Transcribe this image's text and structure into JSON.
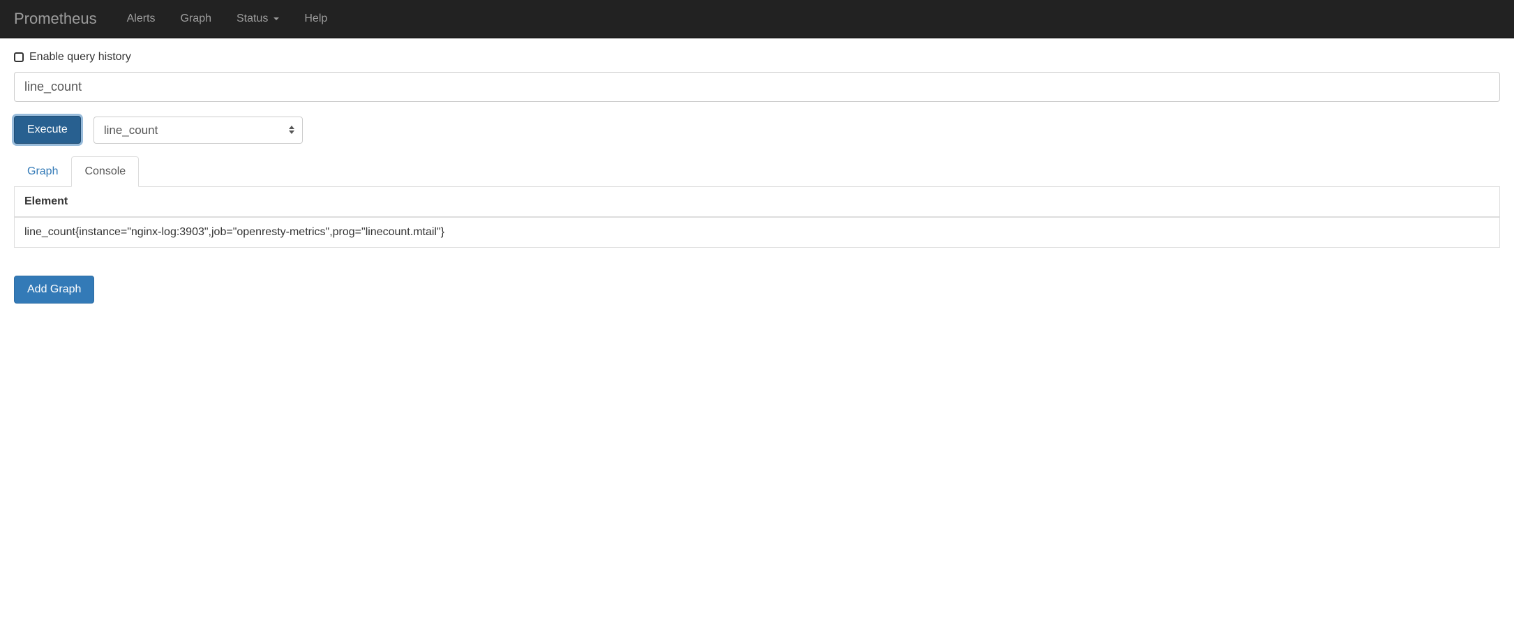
{
  "navbar": {
    "brand": "Prometheus",
    "items": [
      {
        "label": "Alerts"
      },
      {
        "label": "Graph"
      },
      {
        "label": "Status",
        "dropdown": true
      },
      {
        "label": "Help"
      }
    ]
  },
  "query": {
    "enable_history_label": "Enable query history",
    "expression_value": "line_count",
    "execute_label": "Execute",
    "metric_select_value": "line_count"
  },
  "tabs": {
    "graph_label": "Graph",
    "console_label": "Console"
  },
  "results": {
    "header_element": "Element",
    "rows": [
      {
        "element": "line_count{instance=\"nginx-log:3903\",job=\"openresty-metrics\",prog=\"linecount.mtail\"}"
      }
    ]
  },
  "actions": {
    "add_graph_label": "Add Graph"
  }
}
